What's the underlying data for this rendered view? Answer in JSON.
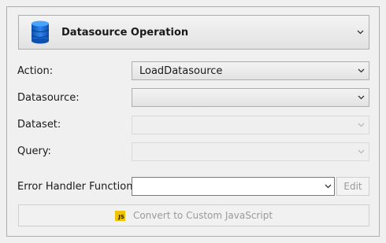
{
  "header": {
    "title": "Datasource Operation",
    "icon": "database-icon"
  },
  "fields": {
    "action": {
      "label": "Action:",
      "value": "LoadDatasource"
    },
    "datasource": {
      "label": "Datasource:",
      "value": ""
    },
    "dataset": {
      "label": "Dataset:",
      "value": ""
    },
    "query": {
      "label": "Query:",
      "value": ""
    },
    "error_handler": {
      "label": "Error Handler Function:",
      "value": "",
      "edit_label": "Edit"
    }
  },
  "convert_button": {
    "label": "Convert to Custom JavaScript",
    "badge": "JS"
  },
  "colors": {
    "accent": "#1e6fd9",
    "badge": "#f0c400",
    "disabled_text": "#9a9a9a"
  }
}
